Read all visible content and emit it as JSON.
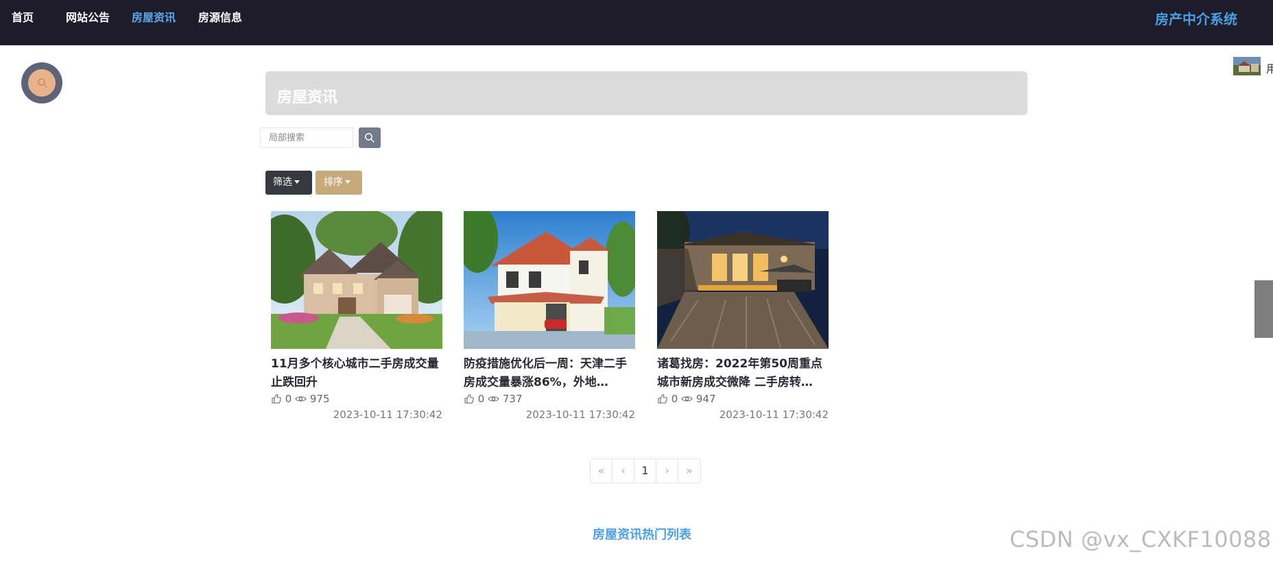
{
  "nav": {
    "items": [
      {
        "label": "首页",
        "active": false
      },
      {
        "label": "网站公告",
        "active": false
      },
      {
        "label": "房屋资讯",
        "active": true
      },
      {
        "label": "房源信息",
        "active": false
      }
    ],
    "brand": "房产中介系统"
  },
  "colors": {
    "topbar": "#1d1d2b",
    "accent": "#4b9fe6",
    "filter_button": "#343a40",
    "sort_button": "#c8a979"
  },
  "page": {
    "title": "房屋资讯",
    "search_placeholder": "局部搜索",
    "filter_label": "筛选",
    "sort_label": "排序",
    "hot_list_title": "房屋资讯热门列表"
  },
  "corner": {
    "text": "用"
  },
  "icons": {
    "float_search": "search-icon",
    "search_button": "search-icon",
    "likes": "thumbs-up-icon",
    "views": "eye-icon"
  },
  "articles": [
    {
      "title": "11月多个核心城市二手房成交量止跌回升",
      "likes": "0",
      "views": "975",
      "date": "2023-10-11 17:30:42"
    },
    {
      "title": "防疫措施优化后一周：天津二手房成交量暴涨86%，外地…",
      "likes": "0",
      "views": "737",
      "date": "2023-10-11 17:30:42"
    },
    {
      "title": "诸葛找房：2022年第50周重点城市新房成交微降 二手房转…",
      "likes": "0",
      "views": "947",
      "date": "2023-10-11 17:30:42"
    }
  ],
  "pagination": {
    "first": "«",
    "prev": "‹",
    "current": "1",
    "next": "›",
    "last": "»"
  },
  "watermark": "CSDN @vx_CXKF10088"
}
